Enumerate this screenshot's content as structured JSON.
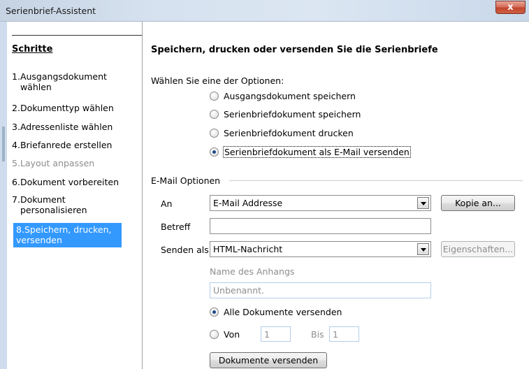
{
  "window": {
    "title": "Serienbrief-Assistent",
    "close_glyph": "x"
  },
  "steps": {
    "heading": "Schritte",
    "items": [
      {
        "num": "1.",
        "label": "Ausgangsdokument wählen"
      },
      {
        "num": "2.",
        "label": "Dokumenttyp wählen"
      },
      {
        "num": "3.",
        "label": "Adressenliste wählen"
      },
      {
        "num": "4.",
        "label": "Briefanrede erstellen"
      },
      {
        "num": "5.",
        "label": "Layout anpassen"
      },
      {
        "num": "6.",
        "label": "Dokument vorbereiten"
      },
      {
        "num": "7.",
        "label": "Dokument personalisieren"
      },
      {
        "num": "8.",
        "label": "Speichern, drucken, versenden"
      }
    ]
  },
  "main": {
    "title": "Speichern, drucken oder versenden Sie die Serienbriefe",
    "choose_label": "Wählen Sie eine der Optionen:",
    "options": [
      {
        "label": "Ausgangsdokument speichern",
        "checked": false
      },
      {
        "label": "Serienbriefdokument speichern",
        "checked": false
      },
      {
        "label": "Serienbriefdokument drucken",
        "checked": false
      },
      {
        "label": "Serienbriefdokument als E-Mail versenden",
        "checked": true
      }
    ],
    "email": {
      "group_label": "E-Mail Optionen",
      "an_label": "An",
      "an_value": "E-Mail Addresse",
      "copy_button": "Kopie an...",
      "betreff_label": "Betreff",
      "betreff_value": "",
      "senden_als_label": "Senden als",
      "senden_als_value": "HTML-Nachricht",
      "eigenschaften_button": "Eigenschaften...",
      "attachment_label": "Name des Anhangs",
      "attachment_value": "Unbenannt.",
      "all_docs_label": "Alle Dokumente versenden",
      "von_label": "Von",
      "von_value": "1",
      "bis_label": "Bis",
      "bis_value": "1",
      "send_button": "Dokumente versenden"
    }
  }
}
